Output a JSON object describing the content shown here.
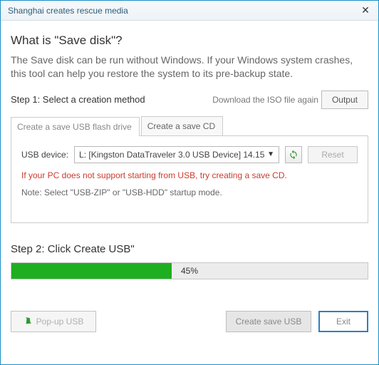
{
  "window": {
    "title": "Shanghai creates rescue media"
  },
  "header": {
    "heading": "What is \"Save disk\"?",
    "description": "The Save disk can be run without Windows. If your Windows system crashes, this tool can help you restore the system to its pre-backup state."
  },
  "step1": {
    "label": "Step 1: Select a creation method",
    "download_link": "Download the ISO file again",
    "output_button": "Output"
  },
  "tabs": {
    "usb": "Create a save USB flash drive",
    "cd": "Create a save CD"
  },
  "usb_panel": {
    "device_label": "USB device:",
    "device_value": "L: [Kingston DataTraveler 3.0 USB Device] 14.15",
    "reset_button": "Reset",
    "warning": "If your PC does not support starting from USB, try creating a save CD.",
    "note": "Note: Select \"USB-ZIP\" or \"USB-HDD\" startup mode."
  },
  "step2": {
    "label": "Step 2: Click Create USB\"",
    "progress_percent": "45%",
    "progress_value": 45
  },
  "buttons": {
    "popup": "Pop-up USB",
    "create": "Create save USB",
    "exit": "Exit"
  }
}
